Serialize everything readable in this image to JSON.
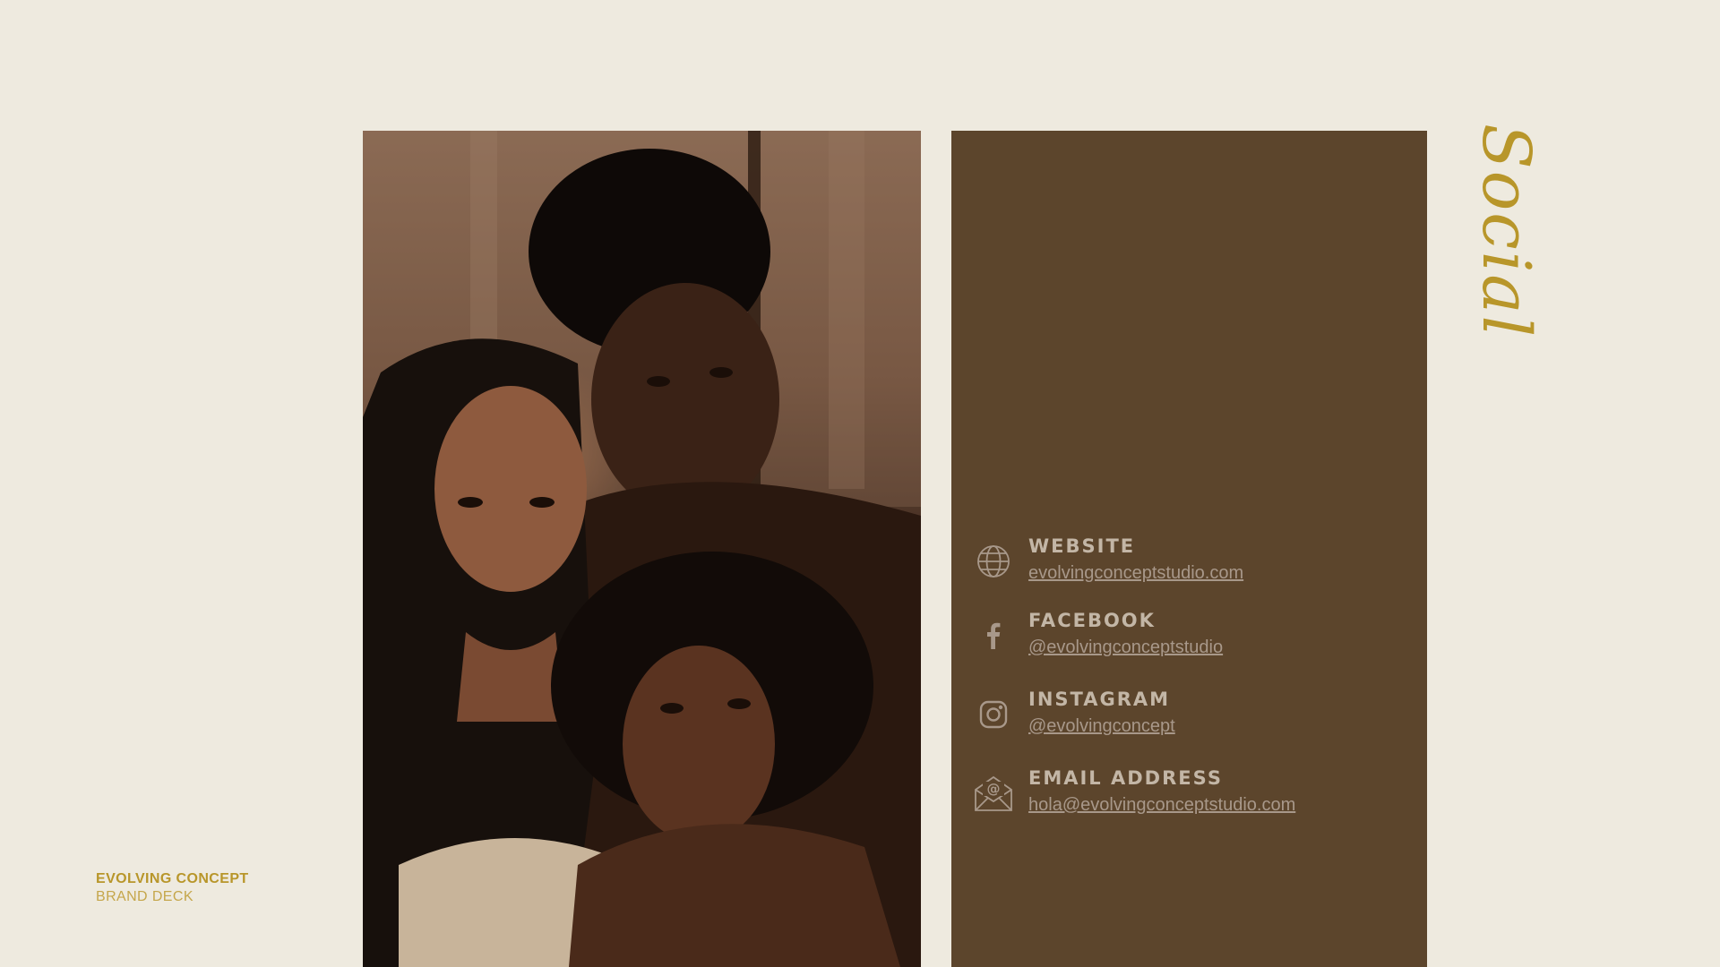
{
  "heading": {
    "text": "Social"
  },
  "contacts": [
    {
      "title": "WEBSITE",
      "value": "evolvingconceptstudio.com",
      "icon": "globe-icon"
    },
    {
      "title": "FACEBOOK",
      "value": "@evolvingconceptstudio",
      "icon": "facebook-icon"
    },
    {
      "title": "INSTAGRAM",
      "value": "@evolvingconcept",
      "icon": "instagram-icon"
    },
    {
      "title": "EMAIL ADDRESS",
      "value": "hola@evolvingconceptstudio.com",
      "icon": "email-icon"
    }
  ],
  "brand": {
    "name": "EVOLVING CONCEPT",
    "subtitle": "BRAND DECK"
  },
  "colors": {
    "background": "#EEEADF",
    "panel": "#5C452C",
    "accent_gold": "#B8962A",
    "contact_title": "#C3B6A6",
    "contact_value": "#A8988A"
  }
}
